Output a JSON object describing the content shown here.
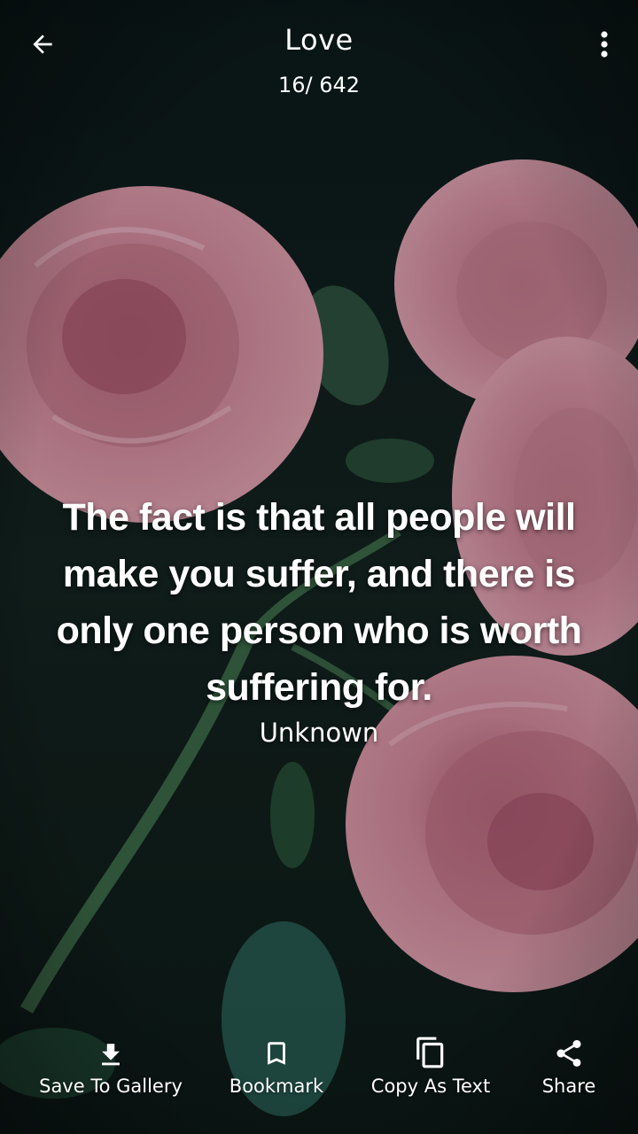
{
  "header": {
    "title": "Love",
    "counter": "16/ 642",
    "back_icon": "arrow-left-icon",
    "menu_icon": "more-vertical-icon"
  },
  "quote": {
    "text": "The fact is that all people will make you suffer, and there is only one person who is worth suffering for.",
    "author": "Unknown"
  },
  "actions": [
    {
      "label": "Save To Gallery",
      "icon": "download-icon"
    },
    {
      "label": "Bookmark",
      "icon": "bookmark-icon"
    },
    {
      "label": "Copy As Text",
      "icon": "copy-icon"
    },
    {
      "label": "Share",
      "icon": "share-icon"
    }
  ],
  "colors": {
    "text": "#ffffff",
    "background": "#101f1b",
    "rose": "#d98a9f"
  }
}
